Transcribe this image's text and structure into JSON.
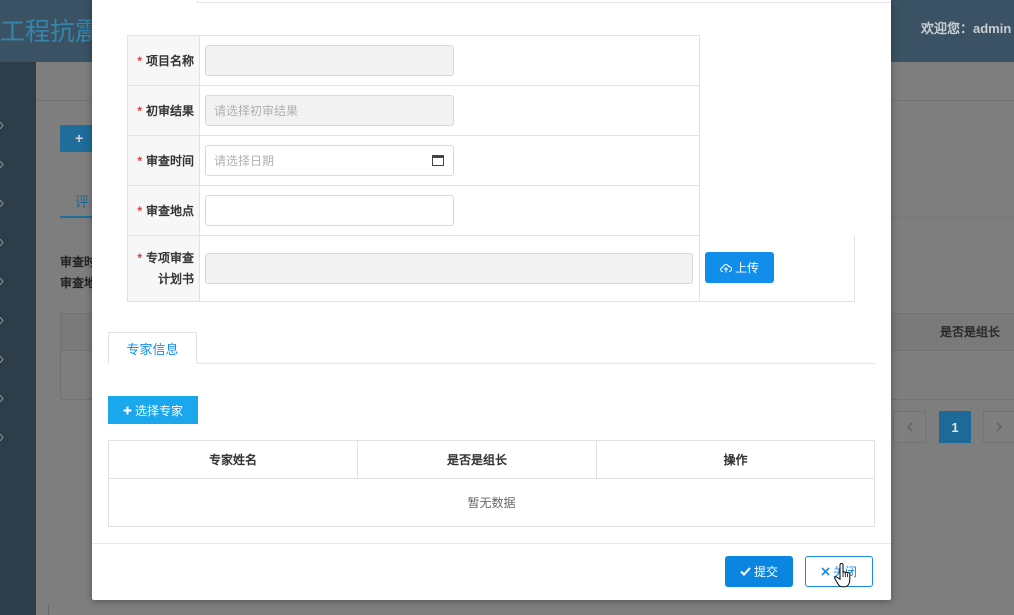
{
  "header": {
    "title": "工程抗震",
    "welcome": "欢迎您：admin"
  },
  "sidebar": {
    "menu_arrow_icon": "chevron-right-icon"
  },
  "background_page": {
    "add_button_label": "+",
    "tab_label": "评",
    "info_lines": [
      "审查时",
      "审查地"
    ],
    "table_header": "是否是组长",
    "pagination": {
      "prev_icon": "chevron-left-icon",
      "current_page": "1",
      "next_icon": "chevron-right-icon"
    }
  },
  "modal": {
    "form": {
      "required_mark": "*",
      "fields": [
        {
          "label": "项目名称",
          "value": "",
          "placeholder": "",
          "disabled": true
        },
        {
          "label": "初审结果",
          "value": "",
          "placeholder": "请选择初审结果",
          "disabled": true
        },
        {
          "label": "审查时间",
          "value": "",
          "placeholder": "请选择日期",
          "disabled": false,
          "icon": "calendar-icon"
        },
        {
          "label": "审查地点",
          "value": "",
          "placeholder": "",
          "disabled": false
        },
        {
          "label_lines": [
            "专项审查",
            "计划书"
          ],
          "value": "",
          "placeholder": "",
          "disabled": true,
          "upload_label": "上传",
          "upload_icon": "cloud-upload-icon"
        }
      ]
    },
    "expert_tab": "专家信息",
    "select_expert": {
      "icon": "plus-icon",
      "label": "选择专家"
    },
    "expert_table": {
      "columns": [
        "专家姓名",
        "是否是组长",
        "操作"
      ],
      "empty_text": "暂无数据"
    },
    "footer": {
      "submit": {
        "icon": "check-icon",
        "label": "提交"
      },
      "close": {
        "icon": "close-icon",
        "label": "关闭"
      }
    }
  },
  "cursor_icon": "hand-pointer-icon",
  "colors": {
    "primary": "#108ee9",
    "select_expert": "#1aa7ee",
    "required": "#e4393c",
    "header_bg": "#3b5264"
  }
}
